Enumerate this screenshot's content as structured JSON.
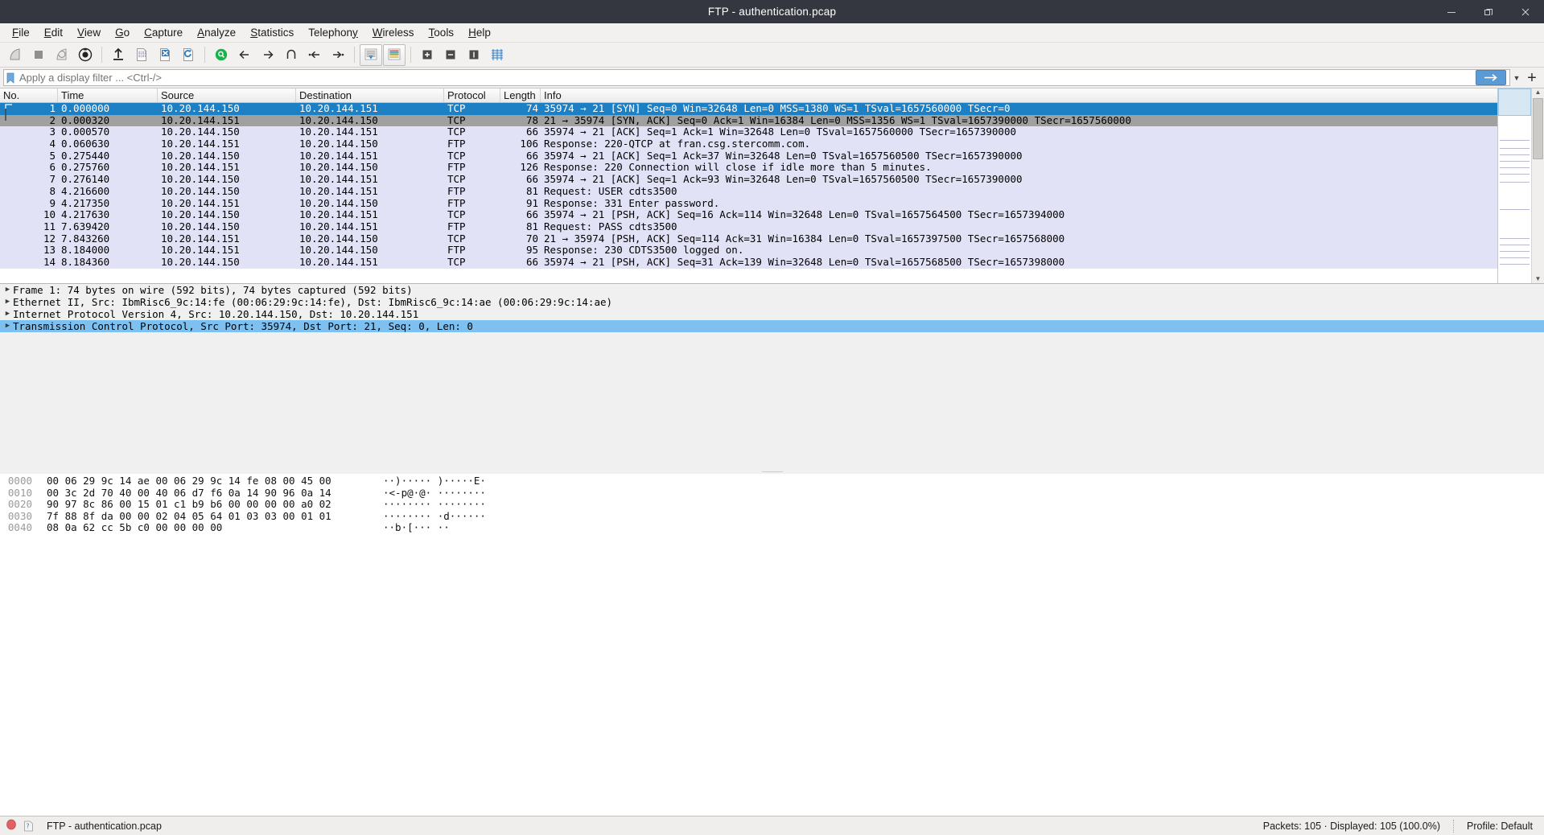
{
  "window": {
    "title": "FTP - authentication.pcap",
    "minimize_label": "minimize-window",
    "maximize_label": "restore-window",
    "close_label": "close-window"
  },
  "menubar": {
    "items": [
      {
        "label": "File",
        "accel": "F"
      },
      {
        "label": "Edit",
        "accel": "E"
      },
      {
        "label": "View",
        "accel": "V"
      },
      {
        "label": "Go",
        "accel": "G"
      },
      {
        "label": "Capture",
        "accel": "C"
      },
      {
        "label": "Analyze",
        "accel": "A"
      },
      {
        "label": "Statistics",
        "accel": "S"
      },
      {
        "label": "Telephony",
        "accel": "y"
      },
      {
        "label": "Wireless",
        "accel": "W"
      },
      {
        "label": "Tools",
        "accel": "T"
      },
      {
        "label": "Help",
        "accel": "H"
      }
    ]
  },
  "toolbar": {
    "buttons": [
      "start-capture-icon",
      "stop-capture-icon",
      "restart-capture-icon",
      "capture-options-icon",
      "open-file-icon",
      "save-file-icon",
      "close-file-icon",
      "reload-file-icon",
      "find-packet-icon",
      "go-back-icon",
      "go-forward-icon",
      "go-to-packet-icon",
      "go-to-first-packet-icon",
      "go-to-last-packet-icon",
      "auto-scroll-icon",
      "colorize-packets-icon",
      "zoom-in-icon",
      "zoom-out-icon",
      "zoom-reset-icon",
      "resize-columns-icon"
    ]
  },
  "filter": {
    "placeholder": "Apply a display filter ... <Ctrl-/>",
    "value": "",
    "bookmark_icon": "bookmark-icon",
    "apply_icon": "apply-filter-arrow-icon",
    "history_icon": "chevron-down-icon",
    "add_icon": "add-filter-button-icon"
  },
  "packet_list": {
    "columns": [
      {
        "key": "no",
        "label": "No."
      },
      {
        "key": "time",
        "label": "Time"
      },
      {
        "key": "source",
        "label": "Source"
      },
      {
        "key": "destination",
        "label": "Destination"
      },
      {
        "key": "protocol",
        "label": "Protocol"
      },
      {
        "key": "length",
        "label": "Length"
      },
      {
        "key": "info",
        "label": "Info"
      }
    ],
    "rows": [
      {
        "no": "1",
        "time": "0.000000",
        "source": "10.20.144.150",
        "destination": "10.20.144.151",
        "protocol": "TCP",
        "length": "74",
        "info": "35974 → 21 [SYN] Seq=0 Win=32648 Len=0 MSS=1380 WS=1 TSval=1657560000 TSecr=0",
        "state": "selected"
      },
      {
        "no": "2",
        "time": "0.000320",
        "source": "10.20.144.151",
        "destination": "10.20.144.150",
        "protocol": "TCP",
        "length": "78",
        "info": "21 → 35974 [SYN, ACK] Seq=0 Ack=1 Win=16384 Len=0 MSS=1356 WS=1 TSval=1657390000 TSecr=1657560000",
        "state": "related"
      },
      {
        "no": "3",
        "time": "0.000570",
        "source": "10.20.144.150",
        "destination": "10.20.144.151",
        "protocol": "TCP",
        "length": "66",
        "info": "35974 → 21 [ACK] Seq=1 Ack=1 Win=32648 Len=0 TSval=1657560000 TSecr=1657390000",
        "state": "normal"
      },
      {
        "no": "4",
        "time": "0.060630",
        "source": "10.20.144.151",
        "destination": "10.20.144.150",
        "protocol": "FTP",
        "length": "106",
        "info": "Response: 220-QTCP at fran.csg.stercomm.com.",
        "state": "normal"
      },
      {
        "no": "5",
        "time": "0.275440",
        "source": "10.20.144.150",
        "destination": "10.20.144.151",
        "protocol": "TCP",
        "length": "66",
        "info": "35974 → 21 [ACK] Seq=1 Ack=37 Win=32648 Len=0 TSval=1657560500 TSecr=1657390000",
        "state": "normal"
      },
      {
        "no": "6",
        "time": "0.275760",
        "source": "10.20.144.151",
        "destination": "10.20.144.150",
        "protocol": "FTP",
        "length": "126",
        "info": "Response: 220 Connection will close if idle more than 5 minutes.",
        "state": "normal"
      },
      {
        "no": "7",
        "time": "0.276140",
        "source": "10.20.144.150",
        "destination": "10.20.144.151",
        "protocol": "TCP",
        "length": "66",
        "info": "35974 → 21 [ACK] Seq=1 Ack=93 Win=32648 Len=0 TSval=1657560500 TSecr=1657390000",
        "state": "normal"
      },
      {
        "no": "8",
        "time": "4.216600",
        "source": "10.20.144.150",
        "destination": "10.20.144.151",
        "protocol": "FTP",
        "length": "81",
        "info": "Request: USER cdts3500",
        "state": "normal"
      },
      {
        "no": "9",
        "time": "4.217350",
        "source": "10.20.144.151",
        "destination": "10.20.144.150",
        "protocol": "FTP",
        "length": "91",
        "info": "Response: 331 Enter password.",
        "state": "normal"
      },
      {
        "no": "10",
        "time": "4.217630",
        "source": "10.20.144.150",
        "destination": "10.20.144.151",
        "protocol": "TCP",
        "length": "66",
        "info": "35974 → 21 [PSH, ACK] Seq=16 Ack=114 Win=32648 Len=0 TSval=1657564500 TSecr=1657394000",
        "state": "normal"
      },
      {
        "no": "11",
        "time": "7.639420",
        "source": "10.20.144.150",
        "destination": "10.20.144.151",
        "protocol": "FTP",
        "length": "81",
        "info": "Request: PASS cdts3500",
        "state": "normal"
      },
      {
        "no": "12",
        "time": "7.843260",
        "source": "10.20.144.151",
        "destination": "10.20.144.150",
        "protocol": "TCP",
        "length": "70",
        "info": "21 → 35974 [PSH, ACK] Seq=114 Ack=31 Win=16384 Len=0 TSval=1657397500 TSecr=1657568000",
        "state": "normal"
      },
      {
        "no": "13",
        "time": "8.184000",
        "source": "10.20.144.151",
        "destination": "10.20.144.150",
        "protocol": "FTP",
        "length": "95",
        "info": "Response: 230 CDTS3500 logged on.",
        "state": "normal"
      },
      {
        "no": "14",
        "time": "8.184360",
        "source": "10.20.144.150",
        "destination": "10.20.144.151",
        "protocol": "TCP",
        "length": "66",
        "info": "35974 → 21 [PSH, ACK] Seq=31 Ack=139 Win=32648 Len=0 TSval=1657568500 TSecr=1657398000",
        "state": "normal"
      }
    ]
  },
  "packet_details": {
    "rows": [
      {
        "label": "Frame 1: 74 bytes on wire (592 bits), 74 bytes captured (592 bits)",
        "selected": false
      },
      {
        "label": "Ethernet II, Src: IbmRisc6_9c:14:fe (00:06:29:9c:14:fe), Dst: IbmRisc6_9c:14:ae (00:06:29:9c:14:ae)",
        "selected": false
      },
      {
        "label": "Internet Protocol Version 4, Src: 10.20.144.150, Dst: 10.20.144.151",
        "selected": false
      },
      {
        "label": "Transmission Control Protocol, Src Port: 35974, Dst Port: 21, Seq: 0, Len: 0",
        "selected": true
      }
    ]
  },
  "packet_bytes": {
    "rows": [
      {
        "offset": "0000",
        "bytes": "00 06 29 9c 14 ae 00 06   29 9c 14 fe 08 00 45 00",
        "ascii": "··)····· )·····E·"
      },
      {
        "offset": "0010",
        "bytes": "00 3c 2d 70 40 00 40 06   d7 f6 0a 14 90 96 0a 14",
        "ascii": "·<-p@·@· ········"
      },
      {
        "offset": "0020",
        "bytes": "90 97 8c 86 00 15 01 c1   b9 b6 00 00 00 00 a0 02",
        "ascii": "········ ········"
      },
      {
        "offset": "0030",
        "bytes": "7f 88 8f da 00 00 02 04   05 64 01 03 03 00 01 01",
        "ascii": "········ ·d······"
      },
      {
        "offset": "0040",
        "bytes": "08 0a 62 cc 5b c0 00 00   00 00",
        "ascii": "··b·[··· ··"
      }
    ]
  },
  "status_bar": {
    "capture_icon": "capture-status-icon",
    "expert_icon": "expert-info-icon",
    "file_label": "FTP - authentication.pcap",
    "packets_label": "Packets: 105 · Displayed: 105 (100.0%)",
    "profile_label": "Profile: Default"
  },
  "colors": {
    "titlebar_bg": "#34373f",
    "chrome_bg": "#f2f1f0",
    "selection_blue": "#1d7fc4",
    "related_gray": "#a0a0a0",
    "tcp_row_bg": "#e2e2f7",
    "detail_selection": "#7ec1f0",
    "filter_apply": "#5b9bd5"
  }
}
